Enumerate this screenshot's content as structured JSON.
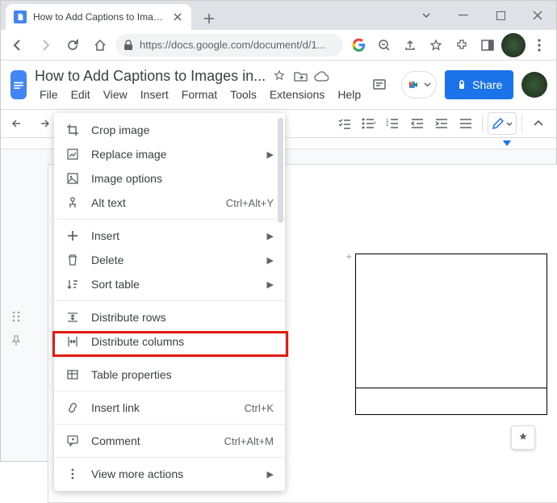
{
  "browser": {
    "tab_title": "How to Add Captions to Images",
    "url": "https://docs.google.com/document/d/1..."
  },
  "docs": {
    "title": "How to Add Captions to Images in...",
    "menus": [
      "File",
      "Edit",
      "View",
      "Insert",
      "Format",
      "Tools",
      "Extensions",
      "Help"
    ],
    "share_label": "Share"
  },
  "context_menu": {
    "items": [
      {
        "icon": "crop",
        "label": "Crop image"
      },
      {
        "icon": "replace",
        "label": "Replace image",
        "submenu": true
      },
      {
        "icon": "image-options",
        "label": "Image options"
      },
      {
        "icon": "alt-text",
        "label": "Alt text",
        "shortcut": "Ctrl+Alt+Y"
      },
      {
        "sep": true
      },
      {
        "icon": "plus",
        "label": "Insert",
        "submenu": true
      },
      {
        "icon": "trash",
        "label": "Delete",
        "submenu": true
      },
      {
        "icon": "sort",
        "label": "Sort table",
        "submenu": true
      },
      {
        "sep": true
      },
      {
        "icon": "dist-rows",
        "label": "Distribute rows"
      },
      {
        "icon": "dist-cols",
        "label": "Distribute columns"
      },
      {
        "sep": true
      },
      {
        "icon": "table-props",
        "label": "Table properties"
      },
      {
        "sep": true
      },
      {
        "icon": "link",
        "label": "Insert link",
        "shortcut": "Ctrl+K"
      },
      {
        "sep": true
      },
      {
        "icon": "comment",
        "label": "Comment",
        "shortcut": "Ctrl+Alt+M"
      },
      {
        "sep": true
      },
      {
        "icon": "more",
        "label": "View more actions",
        "submenu": true
      }
    ],
    "highlighted_label": "Table properties"
  }
}
